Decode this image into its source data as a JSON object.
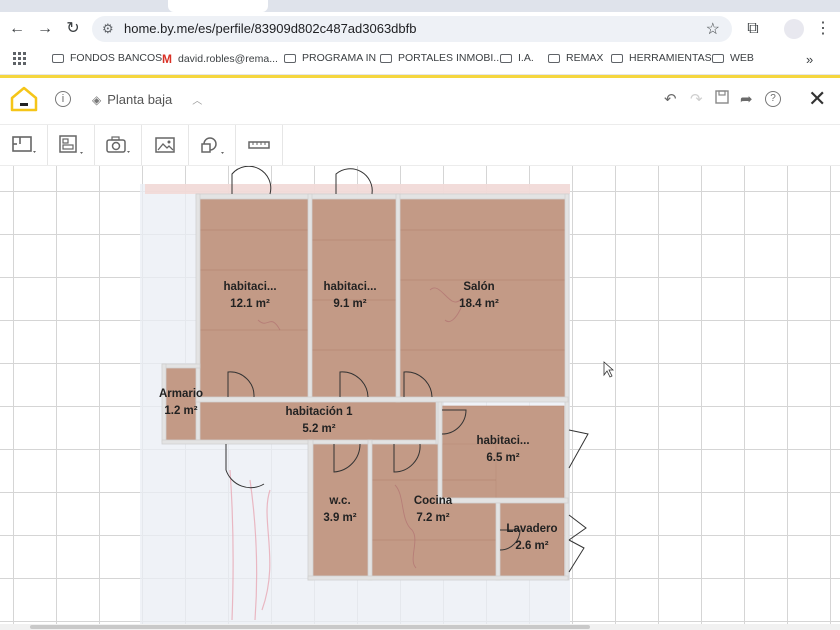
{
  "browser": {
    "url": "home.by.me/es/perfile/83909d802c487ad3063dbfb",
    "bookmarks": [
      {
        "label": "FONDOS BANCOS",
        "icon": "folder-icon"
      },
      {
        "label": "david.robles@rema...",
        "icon": "gmail-icon"
      },
      {
        "label": "PROGRAMA IN",
        "icon": "folder-icon"
      },
      {
        "label": "PORTALES INMOBI...",
        "icon": "folder-icon"
      },
      {
        "label": "I.A.",
        "icon": "folder-icon"
      },
      {
        "label": "REMAX",
        "icon": "folder-icon"
      },
      {
        "label": "HERRAMIENTAS",
        "icon": "folder-icon"
      },
      {
        "label": "WEB",
        "icon": "folder-icon"
      }
    ]
  },
  "app": {
    "floor": "Planta baja",
    "accent_color": "#f5d63d",
    "tools": [
      "floorplan-tool-icon",
      "furniture-tool-icon",
      "camera-tool-icon",
      "image-tool-icon",
      "shapes-tool-icon",
      "ruler-tool-icon"
    ]
  },
  "rooms": [
    {
      "name": "habitaci...",
      "area": "12.1 m²"
    },
    {
      "name": "habitaci...",
      "area": "9.1 m²"
    },
    {
      "name": "Salón",
      "area": "18.4 m²"
    },
    {
      "name": "Armario",
      "area": "1.2 m²"
    },
    {
      "name": "habitación 1",
      "area": "5.2 m²"
    },
    {
      "name": "habitaci...",
      "area": "6.5 m²"
    },
    {
      "name": "w.c.",
      "area": "3.9 m²"
    },
    {
      "name": "Cocina",
      "area": "7.2 m²"
    },
    {
      "name": "Lavadero",
      "area": "2.6 m²"
    }
  ]
}
